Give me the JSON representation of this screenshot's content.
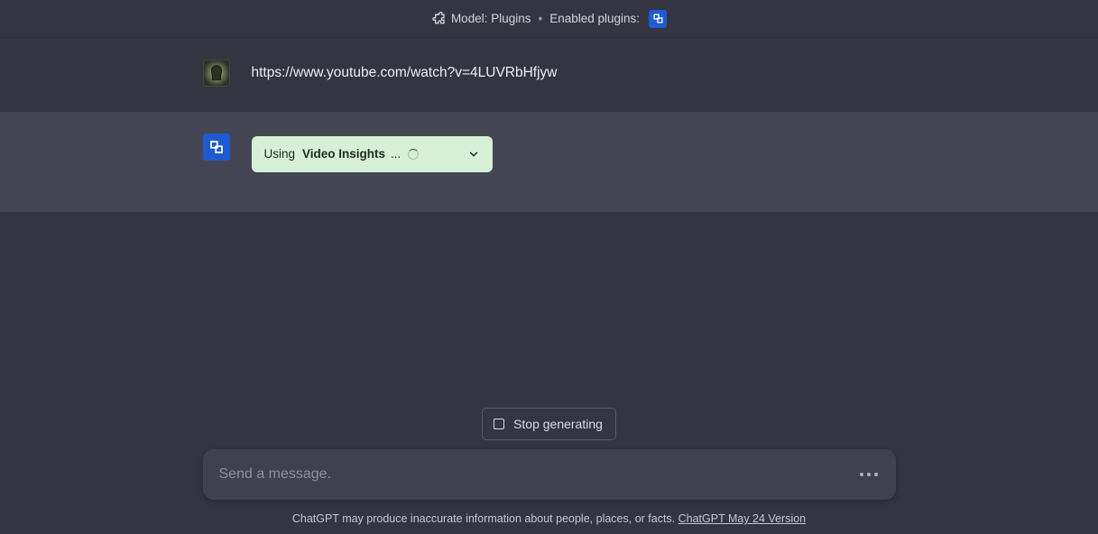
{
  "topbar": {
    "model_label": "Model: Plugins",
    "enabled_label": "Enabled plugins:"
  },
  "messages": {
    "user_text": "https://www.youtube.com/watch?v=4LUVRbHfjyw",
    "plugin_status": {
      "prefix": "Using",
      "name": "Video Insights",
      "suffix": "..."
    }
  },
  "controls": {
    "stop_label": "Stop generating"
  },
  "composer": {
    "placeholder": "Send a message."
  },
  "footer": {
    "disclaimer": "ChatGPT may produce inaccurate information about people, places, or facts. ",
    "version_link": "ChatGPT May 24 Version"
  }
}
